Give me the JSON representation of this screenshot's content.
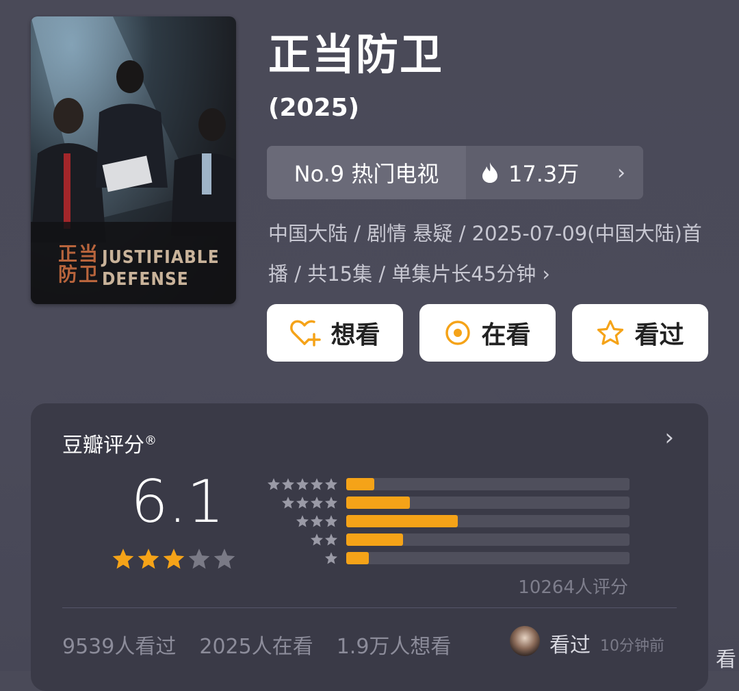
{
  "poster": {
    "title_cn": "正当防卫",
    "title_en": "JUSTIFIABLE DEFENSE"
  },
  "title": "正当防卫",
  "year": "(2025)",
  "rank": {
    "label": "No.9 热门电视",
    "hot_icon": "flame-icon",
    "hot_count": "17.3万",
    "chevron": "›"
  },
  "meta": "中国大陆 / 剧情 悬疑 / 2025-07-09(中国大陆)首播 / 共15集 / 单集片长45分钟 ›",
  "actions": {
    "want_label": "想看",
    "watching_label": "在看",
    "watched_label": "看过"
  },
  "rating": {
    "title": "豆瓣评分",
    "registered": "®",
    "chevron": "›",
    "score": "6.1",
    "stars_filled": 3,
    "stars_total": 5,
    "distribution": [
      {
        "stars": 5,
        "percent": 10
      },
      {
        "stars": 4,
        "percent": 22.5
      },
      {
        "stars": 3,
        "percent": 39.5
      },
      {
        "stars": 2,
        "percent": 20
      },
      {
        "stars": 1,
        "percent": 8
      }
    ],
    "count_text": "10264人评分"
  },
  "stats": {
    "watched": "9539人看过",
    "watching": "2025人在看",
    "want": "1.9万人想看"
  },
  "activity": {
    "action": "看过",
    "time": "10分钟前"
  },
  "edge_glyph": "看",
  "colors": {
    "accent": "#f5a318",
    "background": "#4a4a58",
    "card": "#3a3a47"
  }
}
